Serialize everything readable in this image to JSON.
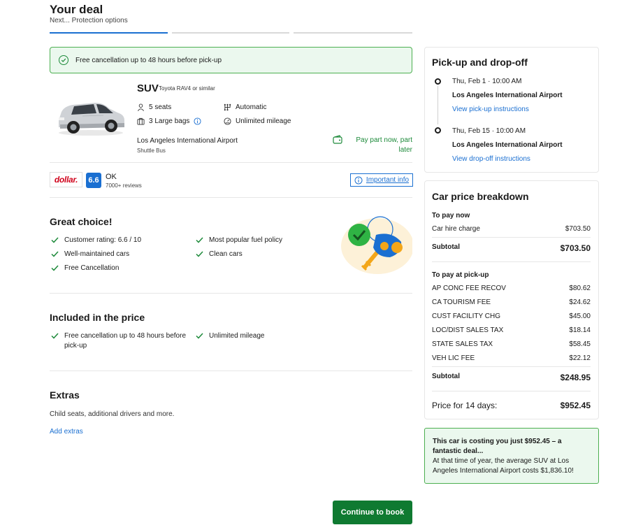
{
  "header": {
    "title": "Your deal",
    "subtitle": "Next... Protection options"
  },
  "banner": {
    "text": "Free cancellation up to 48 hours before pick-up"
  },
  "car": {
    "type": "SUV",
    "model": "Toyota RAV4 or similar",
    "specs": {
      "seats": "5 seats",
      "transmission": "Automatic",
      "bags": "3 Large bags",
      "mileage": "Unlimited mileage"
    },
    "location": "Los Angeles International Airport",
    "location_sub": "Shuttle Bus",
    "pay_option": "Pay part now, part later"
  },
  "supplier": {
    "name": "dollar.",
    "rating": "6.6",
    "rating_label": "OK",
    "reviews": "7000+ reviews",
    "important_info": "Important info"
  },
  "great_choice": {
    "title": "Great choice!",
    "items": [
      "Customer rating: 6.6 / 10",
      "Most popular fuel policy",
      "Well-maintained cars",
      "Clean cars",
      "Free Cancellation"
    ]
  },
  "included": {
    "title": "Included in the price",
    "items": [
      "Free cancellation up to 48 hours before pick-up",
      "Unlimited mileage"
    ]
  },
  "extras": {
    "title": "Extras",
    "description": "Child seats, additional drivers and more.",
    "link": "Add extras"
  },
  "pickup_dropoff": {
    "title": "Pick-up and drop-off",
    "pickup": {
      "date": "Thu, Feb 1 · 10:00 AM",
      "place": "Los Angeles International Airport",
      "link": "View pick-up instructions"
    },
    "dropoff": {
      "date": "Thu, Feb 15 · 10:00 AM",
      "place": "Los Angeles International Airport",
      "link": "View drop-off instructions"
    }
  },
  "price_breakdown": {
    "title": "Car price breakdown",
    "pay_now_heading": "To pay now",
    "pay_now": [
      {
        "label": "Car hire charge",
        "amount": "$703.50"
      }
    ],
    "subtotal_now": {
      "label": "Subtotal",
      "amount": "$703.50"
    },
    "pay_pickup_heading": "To pay at pick-up",
    "pay_pickup": [
      {
        "label": "AP CONC FEE RECOV",
        "amount": "$80.62"
      },
      {
        "label": "CA TOURISM FEE",
        "amount": "$24.62"
      },
      {
        "label": "CUST FACILITY CHG",
        "amount": "$45.00"
      },
      {
        "label": "LOC/DIST SALES TAX",
        "amount": "$18.14"
      },
      {
        "label": "STATE SALES TAX",
        "amount": "$58.45"
      },
      {
        "label": "VEH LIC FEE",
        "amount": "$22.12"
      }
    ],
    "subtotal_pickup": {
      "label": "Subtotal",
      "amount": "$248.95"
    },
    "total": {
      "label": "Price for 14 days:",
      "amount": "$952.45"
    }
  },
  "deal": {
    "headline": "This car is costing you just $952.45 – a fantastic deal...",
    "body": "At that time of year, the average SUV at Los Angeles International Airport costs $1,836.10!"
  },
  "cta": {
    "label": "Continue to book"
  },
  "colors": {
    "accent": "#1a6fd1",
    "success": "#1d8a3a",
    "cta": "#0f7a31",
    "banner_bg": "#ebf8ee"
  }
}
